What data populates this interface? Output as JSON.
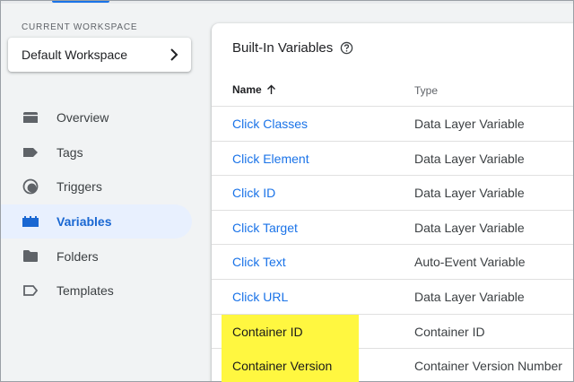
{
  "workspace": {
    "label": "CURRENT WORKSPACE",
    "name": "Default Workspace"
  },
  "nav": {
    "items": [
      {
        "label": "Overview",
        "icon": "overview-icon"
      },
      {
        "label": "Tags",
        "icon": "tag-icon"
      },
      {
        "label": "Triggers",
        "icon": "trigger-icon"
      },
      {
        "label": "Variables",
        "icon": "variables-icon",
        "active": true
      },
      {
        "label": "Folders",
        "icon": "folder-icon"
      },
      {
        "label": "Templates",
        "icon": "template-icon"
      }
    ]
  },
  "card": {
    "title": "Built-In Variables",
    "columns": {
      "name": "Name",
      "type": "Type"
    },
    "rows": [
      {
        "name": "Click Classes",
        "type": "Data Layer Variable"
      },
      {
        "name": "Click Element",
        "type": "Data Layer Variable"
      },
      {
        "name": "Click ID",
        "type": "Data Layer Variable"
      },
      {
        "name": "Click Target",
        "type": "Data Layer Variable"
      },
      {
        "name": "Click Text",
        "type": "Auto-Event Variable"
      },
      {
        "name": "Click URL",
        "type": "Data Layer Variable"
      },
      {
        "name": "Container ID",
        "type": "Container ID"
      },
      {
        "name": "Container Version",
        "type": "Container Version Number"
      }
    ]
  },
  "colors": {
    "accent": "#1a73e8",
    "active_bg": "#e8f0fe",
    "highlight": "#fff740"
  }
}
